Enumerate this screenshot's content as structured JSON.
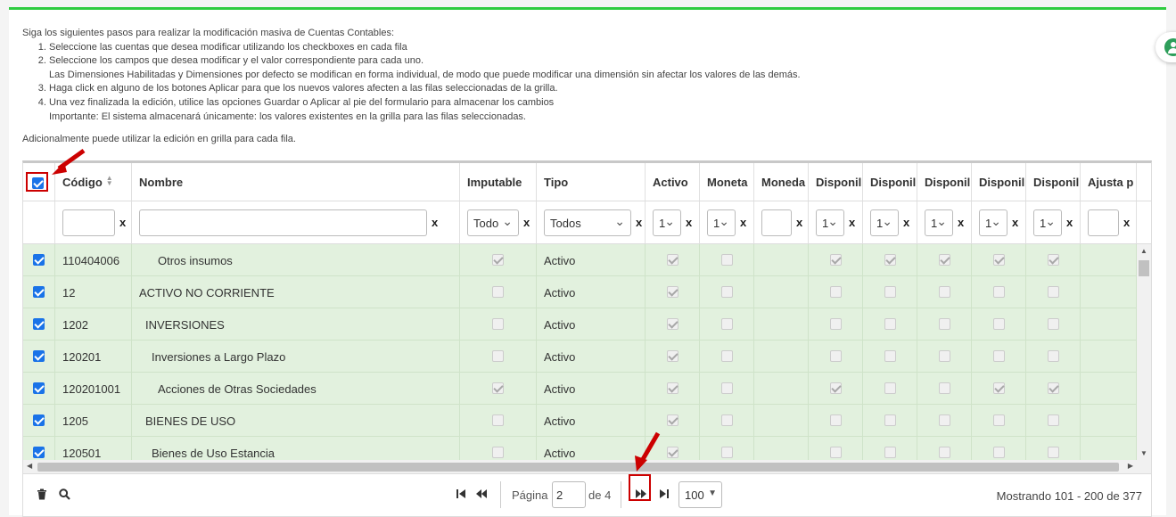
{
  "instructions": {
    "intro": "Siga los siguientes pasos para realizar la modificación masiva de Cuentas Contables:",
    "steps": [
      "Seleccione las cuentas que desea modificar utilizando los checkboxes en cada fila",
      "Seleccione los campos que desea modificar y el valor correspondiente para cada uno.",
      "Haga click en alguno de los botones Aplicar para que los nuevos valores afecten a las filas seleccionadas de la grilla.",
      "Una vez finalizada la edición, utilice las opciones Guardar o Aplicar al pie del formulario para almacenar los cambios"
    ],
    "step2_note": "Las Dimensiones Habilitadas y Dimensiones por defecto se modifican en forma individual, de modo que puede modificar una dimensión sin afectar los valores de las demás.",
    "step4_note": "Importante: El sistema almacenará únicamente: los valores existentes en la grilla para las filas seleccionadas.",
    "extra": "Adicionalmente puede utilizar la edición en grilla para cada fila."
  },
  "grid": {
    "columns": {
      "codigo": "Código",
      "nombre": "Nombre",
      "imputable": "Imputable",
      "tipo": "Tipo",
      "activo": "Activo",
      "moneta": "Moneta",
      "moneda": "Moneda",
      "disp1": "Disponil",
      "disp2": "Disponil",
      "disp3": "Disponil",
      "disp4": "Disponil",
      "disp5": "Disponil",
      "ajusta": "Ajusta p"
    },
    "filters": {
      "clear": "x",
      "imputable_value": "Todo",
      "tipo_value": "Todos",
      "activo_value": "1",
      "moneta_value": "1",
      "disp1_value": "1",
      "disp2_value": "1",
      "disp3_value": "1",
      "disp4_value": "1",
      "disp5_value": "1"
    },
    "rows": [
      {
        "codigo": "110404006",
        "nombre": "Otros insumos",
        "indent": 3,
        "tipo": "Activo",
        "imputable": true,
        "activo": true,
        "moneta": false,
        "disp": [
          true,
          true,
          true,
          true,
          true
        ]
      },
      {
        "codigo": "12",
        "nombre": "ACTIVO NO CORRIENTE",
        "indent": 0,
        "tipo": "Activo",
        "imputable": false,
        "activo": true,
        "moneta": false,
        "disp": [
          false,
          false,
          false,
          false,
          false
        ]
      },
      {
        "codigo": "1202",
        "nombre": "INVERSIONES",
        "indent": 1,
        "tipo": "Activo",
        "imputable": false,
        "activo": true,
        "moneta": false,
        "disp": [
          false,
          false,
          false,
          false,
          false
        ]
      },
      {
        "codigo": "120201",
        "nombre": "Inversiones a Largo Plazo",
        "indent": 2,
        "tipo": "Activo",
        "imputable": false,
        "activo": true,
        "moneta": false,
        "disp": [
          false,
          false,
          false,
          false,
          false
        ]
      },
      {
        "codigo": "120201001",
        "nombre": "Acciones de Otras Sociedades",
        "indent": 3,
        "tipo": "Activo",
        "imputable": true,
        "activo": true,
        "moneta": false,
        "disp": [
          true,
          false,
          false,
          true,
          true
        ]
      },
      {
        "codigo": "1205",
        "nombre": "BIENES DE USO",
        "indent": 1,
        "tipo": "Activo",
        "imputable": false,
        "activo": true,
        "moneta": false,
        "disp": [
          false,
          false,
          false,
          false,
          false
        ]
      },
      {
        "codigo": "120501",
        "nombre": "Bienes de Uso Estancia",
        "indent": 2,
        "tipo": "Activo",
        "imputable": false,
        "activo": true,
        "moneta": false,
        "disp": [
          false,
          false,
          false,
          false,
          false
        ]
      }
    ]
  },
  "pager": {
    "page_label": "Página",
    "page_value": "2",
    "of_label": "de 4",
    "page_size": "100",
    "showing": "Mostrando 101 - 200 de 377"
  },
  "colors": {
    "accent": "#2ecc40",
    "row_selected": "#e2f1de",
    "annotation": "#cc0000"
  },
  "icons": [
    "trash-icon",
    "search-icon",
    "first-page-icon",
    "prev-page-icon",
    "next-page-icon",
    "last-page-icon",
    "user-icon"
  ]
}
